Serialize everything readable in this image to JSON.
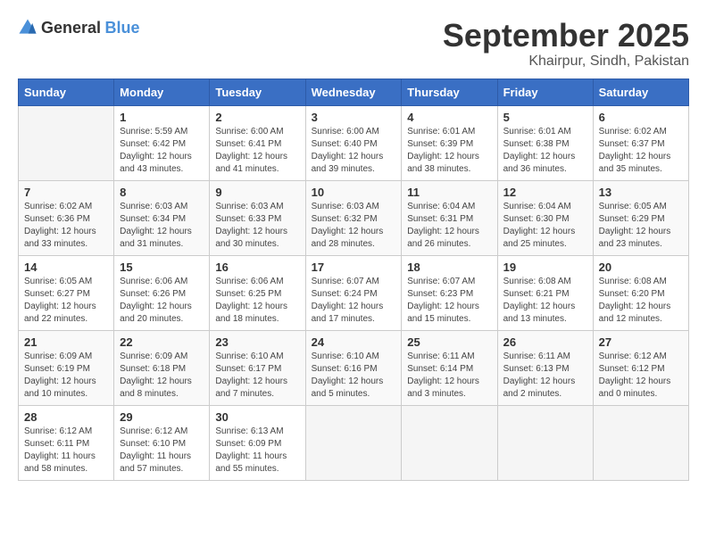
{
  "logo": {
    "general": "General",
    "blue": "Blue"
  },
  "title": "September 2025",
  "location": "Khairpur, Sindh, Pakistan",
  "days_header": [
    "Sunday",
    "Monday",
    "Tuesday",
    "Wednesday",
    "Thursday",
    "Friday",
    "Saturday"
  ],
  "weeks": [
    [
      {
        "day": "",
        "info": ""
      },
      {
        "day": "1",
        "info": "Sunrise: 5:59 AM\nSunset: 6:42 PM\nDaylight: 12 hours\nand 43 minutes."
      },
      {
        "day": "2",
        "info": "Sunrise: 6:00 AM\nSunset: 6:41 PM\nDaylight: 12 hours\nand 41 minutes."
      },
      {
        "day": "3",
        "info": "Sunrise: 6:00 AM\nSunset: 6:40 PM\nDaylight: 12 hours\nand 39 minutes."
      },
      {
        "day": "4",
        "info": "Sunrise: 6:01 AM\nSunset: 6:39 PM\nDaylight: 12 hours\nand 38 minutes."
      },
      {
        "day": "5",
        "info": "Sunrise: 6:01 AM\nSunset: 6:38 PM\nDaylight: 12 hours\nand 36 minutes."
      },
      {
        "day": "6",
        "info": "Sunrise: 6:02 AM\nSunset: 6:37 PM\nDaylight: 12 hours\nand 35 minutes."
      }
    ],
    [
      {
        "day": "7",
        "info": "Sunrise: 6:02 AM\nSunset: 6:36 PM\nDaylight: 12 hours\nand 33 minutes."
      },
      {
        "day": "8",
        "info": "Sunrise: 6:03 AM\nSunset: 6:34 PM\nDaylight: 12 hours\nand 31 minutes."
      },
      {
        "day": "9",
        "info": "Sunrise: 6:03 AM\nSunset: 6:33 PM\nDaylight: 12 hours\nand 30 minutes."
      },
      {
        "day": "10",
        "info": "Sunrise: 6:03 AM\nSunset: 6:32 PM\nDaylight: 12 hours\nand 28 minutes."
      },
      {
        "day": "11",
        "info": "Sunrise: 6:04 AM\nSunset: 6:31 PM\nDaylight: 12 hours\nand 26 minutes."
      },
      {
        "day": "12",
        "info": "Sunrise: 6:04 AM\nSunset: 6:30 PM\nDaylight: 12 hours\nand 25 minutes."
      },
      {
        "day": "13",
        "info": "Sunrise: 6:05 AM\nSunset: 6:29 PM\nDaylight: 12 hours\nand 23 minutes."
      }
    ],
    [
      {
        "day": "14",
        "info": "Sunrise: 6:05 AM\nSunset: 6:27 PM\nDaylight: 12 hours\nand 22 minutes."
      },
      {
        "day": "15",
        "info": "Sunrise: 6:06 AM\nSunset: 6:26 PM\nDaylight: 12 hours\nand 20 minutes."
      },
      {
        "day": "16",
        "info": "Sunrise: 6:06 AM\nSunset: 6:25 PM\nDaylight: 12 hours\nand 18 minutes."
      },
      {
        "day": "17",
        "info": "Sunrise: 6:07 AM\nSunset: 6:24 PM\nDaylight: 12 hours\nand 17 minutes."
      },
      {
        "day": "18",
        "info": "Sunrise: 6:07 AM\nSunset: 6:23 PM\nDaylight: 12 hours\nand 15 minutes."
      },
      {
        "day": "19",
        "info": "Sunrise: 6:08 AM\nSunset: 6:21 PM\nDaylight: 12 hours\nand 13 minutes."
      },
      {
        "day": "20",
        "info": "Sunrise: 6:08 AM\nSunset: 6:20 PM\nDaylight: 12 hours\nand 12 minutes."
      }
    ],
    [
      {
        "day": "21",
        "info": "Sunrise: 6:09 AM\nSunset: 6:19 PM\nDaylight: 12 hours\nand 10 minutes."
      },
      {
        "day": "22",
        "info": "Sunrise: 6:09 AM\nSunset: 6:18 PM\nDaylight: 12 hours\nand 8 minutes."
      },
      {
        "day": "23",
        "info": "Sunrise: 6:10 AM\nSunset: 6:17 PM\nDaylight: 12 hours\nand 7 minutes."
      },
      {
        "day": "24",
        "info": "Sunrise: 6:10 AM\nSunset: 6:16 PM\nDaylight: 12 hours\nand 5 minutes."
      },
      {
        "day": "25",
        "info": "Sunrise: 6:11 AM\nSunset: 6:14 PM\nDaylight: 12 hours\nand 3 minutes."
      },
      {
        "day": "26",
        "info": "Sunrise: 6:11 AM\nSunset: 6:13 PM\nDaylight: 12 hours\nand 2 minutes."
      },
      {
        "day": "27",
        "info": "Sunrise: 6:12 AM\nSunset: 6:12 PM\nDaylight: 12 hours\nand 0 minutes."
      }
    ],
    [
      {
        "day": "28",
        "info": "Sunrise: 6:12 AM\nSunset: 6:11 PM\nDaylight: 11 hours\nand 58 minutes."
      },
      {
        "day": "29",
        "info": "Sunrise: 6:12 AM\nSunset: 6:10 PM\nDaylight: 11 hours\nand 57 minutes."
      },
      {
        "day": "30",
        "info": "Sunrise: 6:13 AM\nSunset: 6:09 PM\nDaylight: 11 hours\nand 55 minutes."
      },
      {
        "day": "",
        "info": ""
      },
      {
        "day": "",
        "info": ""
      },
      {
        "day": "",
        "info": ""
      },
      {
        "day": "",
        "info": ""
      }
    ]
  ]
}
